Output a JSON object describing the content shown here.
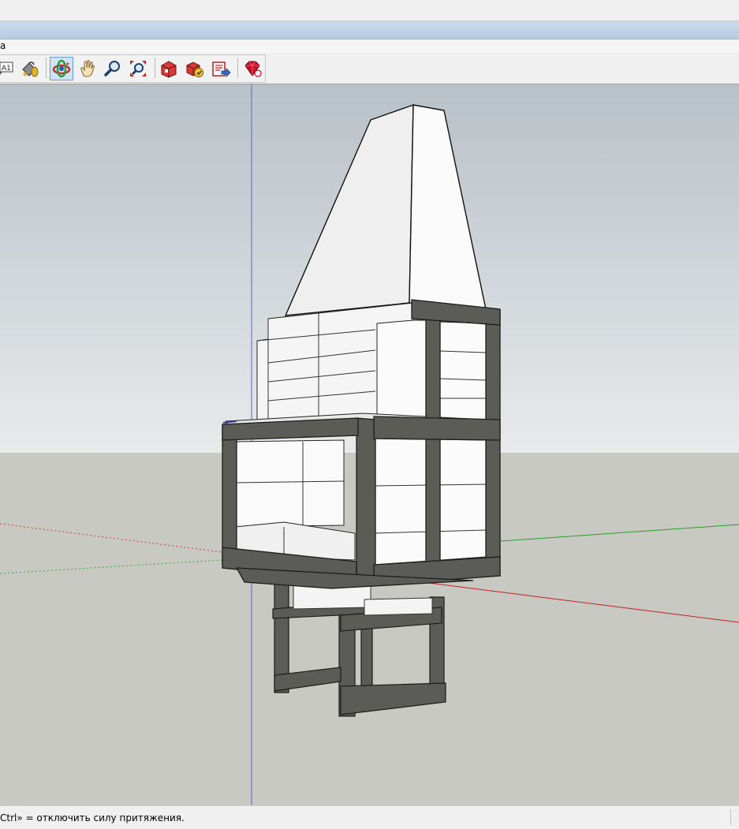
{
  "menubar": {
    "visible_text": "a"
  },
  "toolbar": {
    "tools": [
      {
        "name": "section-tool",
        "icon": "text-label-icon",
        "label": "A1"
      },
      {
        "name": "paint-bucket-tool",
        "icon": "paint-bucket-icon"
      },
      {
        "name": "orbit-tool",
        "icon": "orbit-icon",
        "active": true
      },
      {
        "name": "pan-tool",
        "icon": "hand-pan-icon"
      },
      {
        "name": "zoom-tool",
        "icon": "magnifier-icon"
      },
      {
        "name": "zoom-extents-tool",
        "icon": "zoom-extents-icon"
      },
      {
        "name": "3d-warehouse-tool",
        "icon": "warehouse-icon"
      },
      {
        "name": "components-tool",
        "icon": "components-icon"
      },
      {
        "name": "share-model-tool",
        "icon": "share-model-icon"
      },
      {
        "name": "ruby-console-tool",
        "icon": "ruby-gem-icon"
      }
    ]
  },
  "status": {
    "message": "Ctrl» = отключить силу притяжения."
  },
  "colors": {
    "sky_top": "#b9c2c9",
    "sky_bottom": "#e7e9ea",
    "ground": "#c9c9c4",
    "axis_red": "#d43a3a",
    "axis_green": "#3aa83a",
    "axis_blue": "#5a64c8",
    "steel": "#5b5b57",
    "block": "#f4f4f4",
    "toolbar_active": "#cfe3f7"
  }
}
